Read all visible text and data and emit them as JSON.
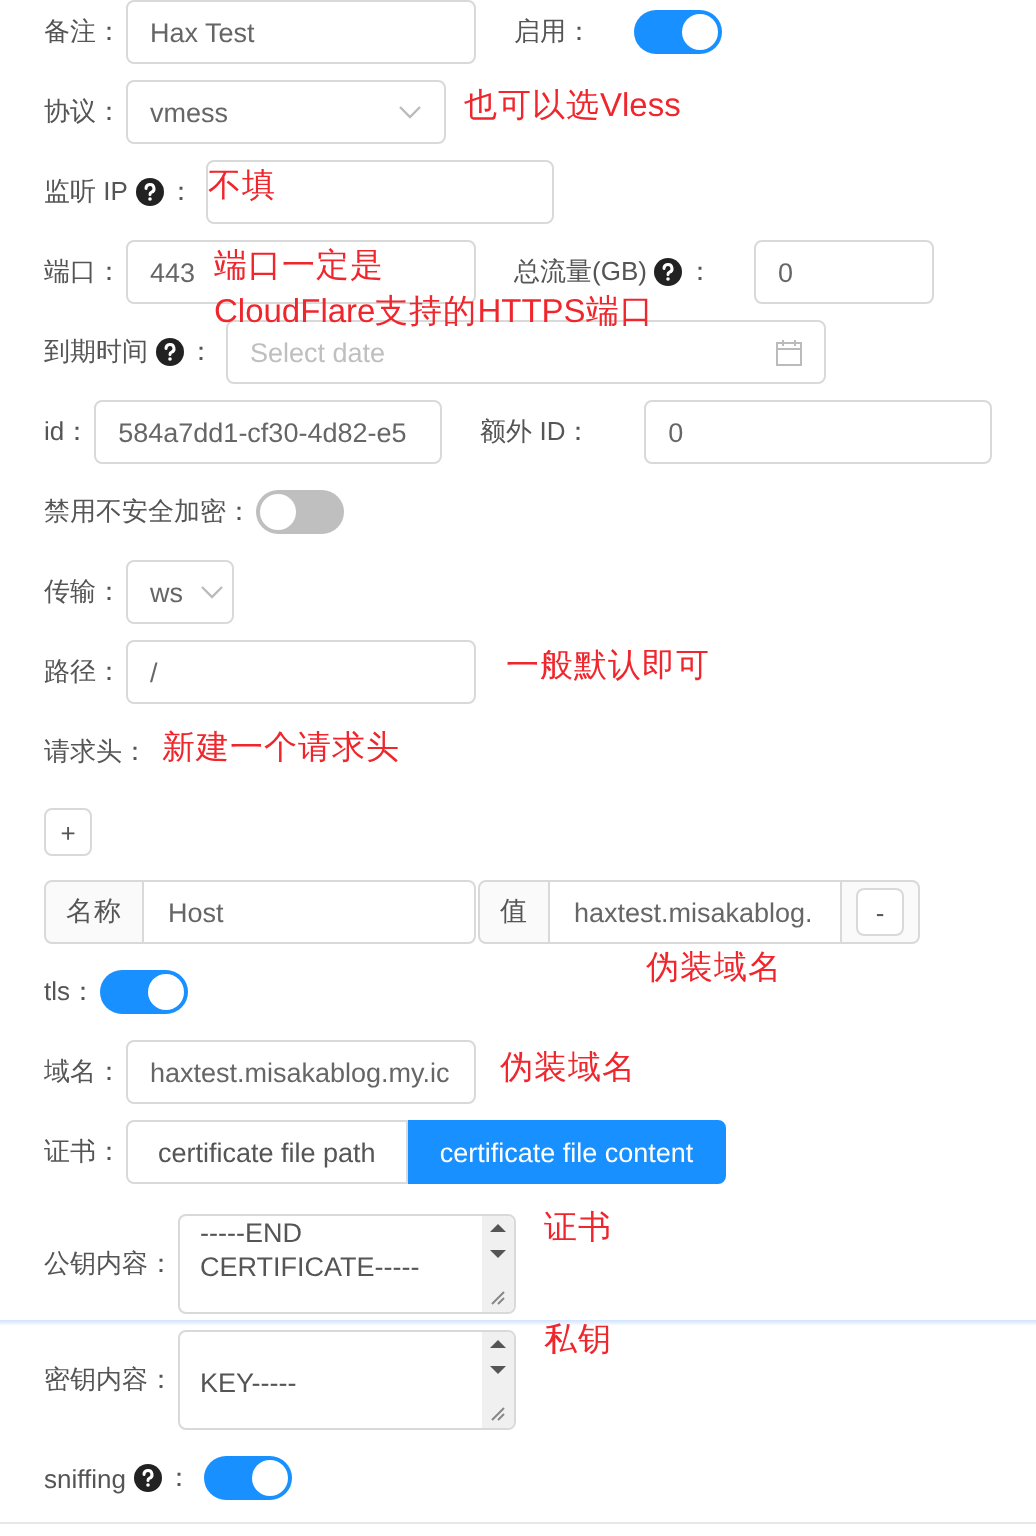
{
  "rows": [
    {
      "items": [
        {
          "kind": "input",
          "label": "备注：",
          "value": "Hax Test"
        },
        {
          "kind": "toggle",
          "label": "启用：",
          "on": true
        }
      ]
    },
    {
      "items": [
        {
          "kind": "select",
          "label": "协议：",
          "value": "vmess"
        }
      ]
    },
    {
      "items": [
        {
          "kind": "input",
          "label": "监听 IP",
          "help": true,
          "colon": "："
        }
      ]
    },
    {
      "items": [
        {
          "kind": "input",
          "label": "端口：",
          "value": "443"
        },
        {
          "kind": "input",
          "label": "总流量(GB)",
          "help": true,
          "colon": "：",
          "value": "0"
        }
      ]
    },
    {
      "items": [
        {
          "kind": "date",
          "label": "到期时间",
          "help": true,
          "colon": "：",
          "placeholder": "Select date"
        }
      ]
    },
    {
      "items": [
        {
          "kind": "input",
          "label": "id：",
          "value": "584a7dd1-cf30-4d82-e5"
        },
        {
          "kind": "input",
          "label": "额外 ID：",
          "value": "0"
        }
      ]
    },
    {
      "items": [
        {
          "kind": "toggle",
          "label": "禁用不安全加密：",
          "on": false
        }
      ]
    },
    {
      "items": [
        {
          "kind": "select",
          "label": "传输：",
          "value": "ws"
        }
      ]
    },
    {
      "items": [
        {
          "kind": "input",
          "label": "路径：",
          "value": "/"
        }
      ]
    },
    {
      "items": [
        {
          "kind": "label",
          "label": "请求头："
        }
      ]
    },
    {
      "items": [
        {
          "kind": "add",
          "text": "+"
        }
      ]
    },
    {
      "items": [
        {
          "kind": "header",
          "name_addon": "名称",
          "name_value": "Host",
          "value_addon": "值",
          "value_value": "haxtest.misakablog.",
          "remove": "-"
        }
      ]
    },
    {
      "items": [
        {
          "kind": "toggle",
          "label": "tls：",
          "on": true
        }
      ]
    },
    {
      "items": [
        {
          "kind": "input",
          "label": "域名：",
          "value": "haxtest.misakablog.my.ic"
        }
      ]
    },
    {
      "items": [
        {
          "kind": "segmented",
          "label": "证书：",
          "options": [
            {
              "label": "certificate file path",
              "selected": false
            },
            {
              "label": "certificate file content",
              "selected": true
            }
          ]
        }
      ]
    },
    {
      "items": [
        {
          "kind": "textarea",
          "label": "公钥内容：",
          "lines": [
            "-----END",
            "CERTIFICATE-----"
          ]
        }
      ]
    },
    {
      "items": [
        {
          "kind": "textarea",
          "label": "密钥内容：",
          "lines": [
            "KEY-----"
          ]
        }
      ]
    },
    {
      "items": [
        {
          "kind": "toggle",
          "label": "sniffing",
          "help": true,
          "colon": "：",
          "on": true
        }
      ]
    }
  ],
  "annotations": [
    "也可以选Vless",
    "不填",
    "端口一定是",
    "CloudFlare支持的HTTPS端口",
    "一般默认即可",
    "新建一个请求头",
    "伪装域名",
    "伪装域名",
    "证书",
    "私钥"
  ]
}
